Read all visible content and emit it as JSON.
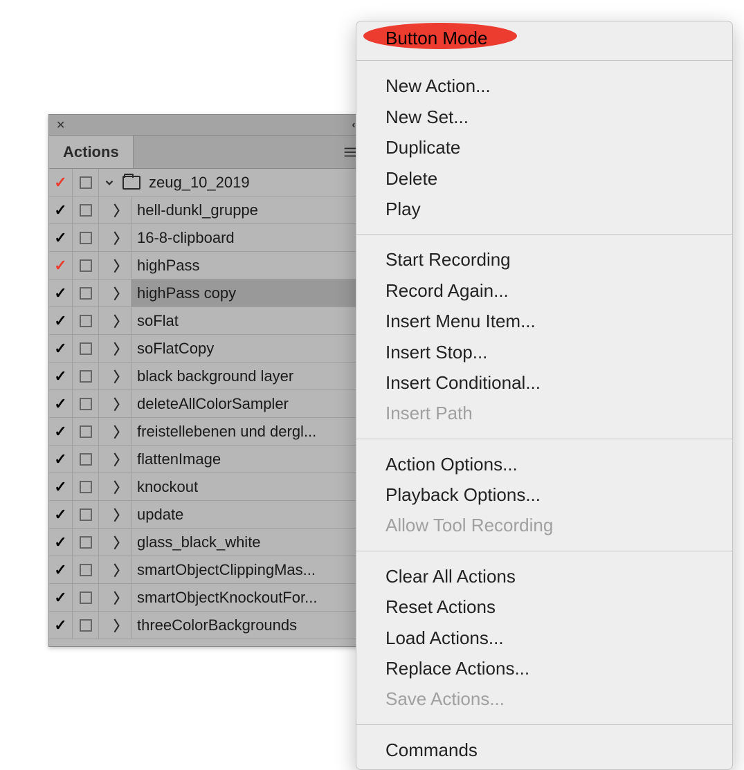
{
  "panel": {
    "tab_title": "Actions",
    "set_name": "zeug_10_2019",
    "rows": [
      {
        "label": "hell-dunkl_gruppe",
        "check": "black"
      },
      {
        "label": "16-8-clipboard",
        "check": "black"
      },
      {
        "label": "highPass",
        "check": "red"
      },
      {
        "label": "highPass copy",
        "check": "black",
        "selected": true
      },
      {
        "label": "soFlat",
        "check": "black"
      },
      {
        "label": "soFlatCopy",
        "check": "black"
      },
      {
        "label": "black background layer",
        "check": "black"
      },
      {
        "label": "deleteAllColorSampler",
        "check": "black"
      },
      {
        "label": "freistellebenen und dergl...",
        "check": "black"
      },
      {
        "label": "flattenImage",
        "check": "black"
      },
      {
        "label": "knockout",
        "check": "black"
      },
      {
        "label": "update",
        "check": "black"
      },
      {
        "label": "glass_black_white",
        "check": "black"
      },
      {
        "label": "smartObjectClippingMas...",
        "check": "black"
      },
      {
        "label": "smartObjectKnockoutFor...",
        "check": "black"
      },
      {
        "label": "threeColorBackgrounds",
        "check": "black"
      }
    ]
  },
  "menu": {
    "highlighted": "Button Mode",
    "groups": [
      [
        {
          "label": "New Action...",
          "enabled": true
        },
        {
          "label": "New Set...",
          "enabled": true
        },
        {
          "label": "Duplicate",
          "enabled": true
        },
        {
          "label": "Delete",
          "enabled": true
        },
        {
          "label": "Play",
          "enabled": true
        }
      ],
      [
        {
          "label": "Start Recording",
          "enabled": true
        },
        {
          "label": "Record Again...",
          "enabled": true
        },
        {
          "label": "Insert Menu Item...",
          "enabled": true
        },
        {
          "label": "Insert Stop...",
          "enabled": true
        },
        {
          "label": "Insert Conditional...",
          "enabled": true
        },
        {
          "label": "Insert Path",
          "enabled": false
        }
      ],
      [
        {
          "label": "Action Options...",
          "enabled": true
        },
        {
          "label": "Playback Options...",
          "enabled": true
        },
        {
          "label": "Allow Tool Recording",
          "enabled": false
        }
      ],
      [
        {
          "label": "Clear All Actions",
          "enabled": true
        },
        {
          "label": "Reset Actions",
          "enabled": true
        },
        {
          "label": "Load Actions...",
          "enabled": true
        },
        {
          "label": "Replace Actions...",
          "enabled": true
        },
        {
          "label": "Save Actions...",
          "enabled": false
        }
      ],
      [
        {
          "label": "Commands",
          "enabled": true
        }
      ]
    ]
  }
}
